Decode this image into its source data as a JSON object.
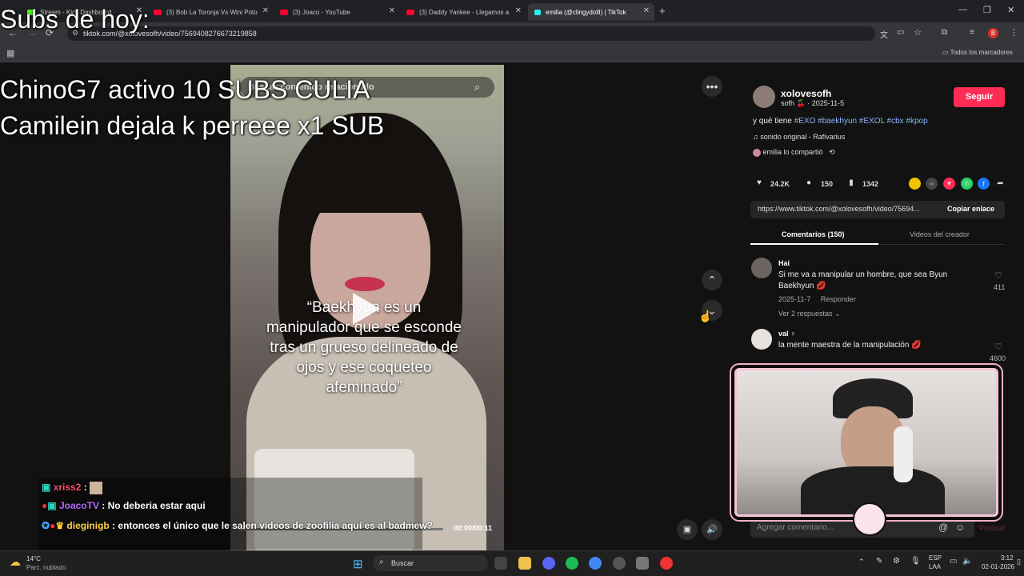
{
  "overlay": {
    "subs_title": "Subs de hoy:",
    "line1": "ChinoG7 activo 10 SUBS CULIA",
    "line2": "Camilein dejala k perreee x1 SUB"
  },
  "tabs": [
    {
      "label": "Stream - Kick Dashboard",
      "favcolor": "#53fc18"
    },
    {
      "label": "(3) Bob La Toronja Vs Wini Poto",
      "favcolor": "#ff0033"
    },
    {
      "label": "(3) Joaco - YouTube",
      "favcolor": "#ff0033"
    },
    {
      "label": "(3) Daddy Yankee - Llegamos a",
      "favcolor": "#ff0033"
    },
    {
      "label": "emilia (@clingydolll) | TikTok",
      "favcolor": "#25f4ee"
    }
  ],
  "address": {
    "url": "tiktok.com/@xolovesofh/video/7569408276673219858"
  },
  "bookmarks": {
    "all_label": "Todos los marcadores"
  },
  "video": {
    "search_placeholder": "Buscar contenido relacionado",
    "caption": "“Baekhyun es un manipulador que se esconde tras un grueso delineado de ojos y ese coqueteo afeminado”",
    "time": "00:00/00:11"
  },
  "author": {
    "username": "xolovesofh",
    "subline": "sofh 🍒 · 2025-11-5",
    "follow_label": "Seguir",
    "description_prefix": "y qué tiene",
    "hashtags": "#EXO #baekhyun #EXOL #cbx #kpop",
    "sound": "sonido original - Rafivarius",
    "shared": "emilia lo compartió"
  },
  "stats": {
    "likes": "24.2K",
    "comments": "150",
    "saves": "1342"
  },
  "share": {
    "link": "https://www.tiktok.com/@xolovesofh/video/75694...",
    "copy_label": "Copiar enlace"
  },
  "tabs_panel": {
    "comments": "Comentarios (150)",
    "creator": "Videos del creador"
  },
  "comments": [
    {
      "user": "Hai",
      "text": "Si me va a manipular un hombre, que sea Byun Baekhyun 💋",
      "date": "2025-11-7",
      "reply": "Responder",
      "replies": "Ver 2 respuestas",
      "likes": "411"
    },
    {
      "user": "val ♀",
      "text": "la mente maestra de la manipulación 💋",
      "likes": "4600"
    }
  ],
  "comment_box": {
    "placeholder": "Agregar comentario...",
    "publish": "Publicar"
  },
  "chat": [
    {
      "user": "xriss2",
      "color": "#ff4d6d",
      "text": ""
    },
    {
      "user": "JoacoTV",
      "color": "#b36bff",
      "text": "No deberia estar aqui"
    },
    {
      "user": "dieginigb",
      "color": "#ffd24d",
      "text": "entonces el único que le salen videos de zoofilia aquí es al badmew?"
    }
  ],
  "taskbar": {
    "temp": "14°C",
    "weather": "Parc. nublado",
    "search": "Buscar",
    "lang1": "ESP",
    "lang2": "LAA",
    "time": "3:12",
    "date": "02-01-2026"
  },
  "colors": {
    "follow": "#fe2c55",
    "hashtag": "#8ab4f8",
    "underline": "#ffffff"
  }
}
